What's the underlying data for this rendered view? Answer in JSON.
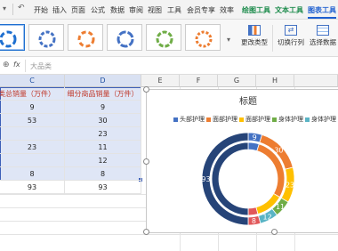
{
  "menubar": {
    "items": [
      "开始",
      "插入",
      "页面",
      "公式",
      "数据",
      "审阅",
      "视图",
      "工具",
      "会员专享",
      "效率",
      "绘图工具",
      "文本工具",
      "图表工具"
    ]
  },
  "ribbon": {
    "change_type": "更改类型",
    "switch_row_col": "切换行列",
    "select_data": "选择数据"
  },
  "formula_bar": {
    "fx": "fx",
    "value": "大品类"
  },
  "columns": [
    "C",
    "D",
    "E",
    "F",
    "G",
    "H"
  ],
  "table": {
    "header_c": "品类总销量（万件）",
    "header_d": "细分商品销量（万件）",
    "rows": [
      [
        "9",
        "9"
      ],
      [
        "53",
        "30"
      ],
      [
        "",
        "23"
      ],
      [
        "23",
        "11"
      ],
      [
        "",
        "12"
      ],
      [
        "8",
        "8"
      ],
      [
        "93",
        "93"
      ]
    ]
  },
  "chart_data": {
    "type": "doughnut",
    "title": "标题",
    "legend_position": "top",
    "categories": [
      "头部护理",
      "面部护理",
      "面部护理",
      "身体护理",
      "身体护理",
      ""
    ],
    "series": [
      {
        "values": [
          9,
          30,
          23,
          11,
          12,
          8,
          93
        ]
      },
      {
        "values": [
          9,
          53,
          23,
          8,
          93
        ]
      }
    ],
    "colors": [
      "#4472c4",
      "#ed7d31",
      "#ffc000",
      "#70ad47",
      "#5ab4c5",
      "#e15759",
      "#264478"
    ],
    "data_labels": [
      "9",
      "30",
      "23",
      "11",
      "12",
      "8",
      "93"
    ]
  }
}
